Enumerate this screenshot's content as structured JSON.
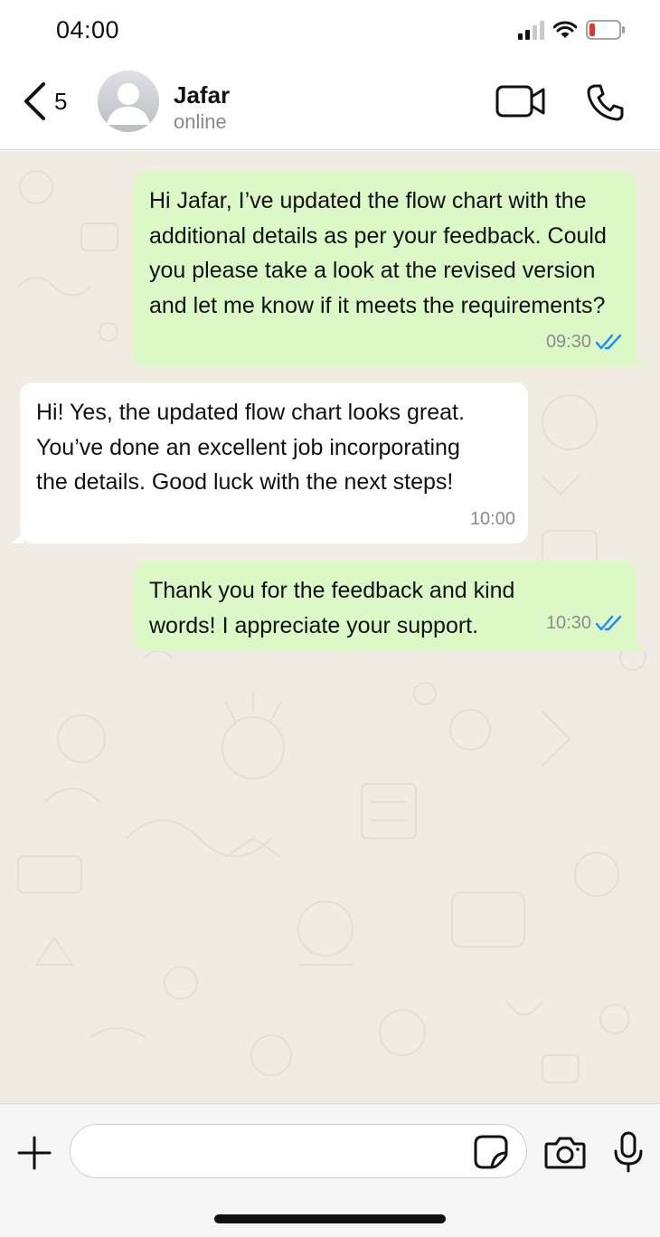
{
  "status_bar": {
    "time": "04:00",
    "icons": [
      "signal-icon",
      "wifi-icon",
      "battery-icon"
    ],
    "battery_color": "#e8342b"
  },
  "header": {
    "back_count": "5",
    "contact_name": "Jafar",
    "contact_status": "online",
    "icons": [
      "chevron-left-icon",
      "avatar-placeholder-icon",
      "video-call-icon",
      "phone-icon"
    ]
  },
  "messages": [
    {
      "direction": "outgoing",
      "text": "Hi Jafar, I’ve updated the flow chart with the additional details as per your feedback. Could you please take a look at the revised version and let me know if it meets the requirements?",
      "time": "09:30",
      "read": true
    },
    {
      "direction": "incoming",
      "text": "Hi! Yes, the updated flow chart looks great. You’ve done an excellent job incorporating the details. Good luck with the next steps!",
      "time": "10:00"
    },
    {
      "direction": "outgoing",
      "text": "Thank you for the feedback and kind words! I appreciate your support.",
      "time": "10:30",
      "read": true
    }
  ],
  "input_bar": {
    "value": "",
    "placeholder": "",
    "icons": [
      "plus-icon",
      "sticker-icon",
      "camera-icon",
      "microphone-icon"
    ]
  },
  "colors": {
    "outgoing_bubble": "#dcf8c7",
    "incoming_bubble": "#ffffff",
    "chat_background": "#f0ebe3",
    "read_ticks": "#1a8cff"
  }
}
